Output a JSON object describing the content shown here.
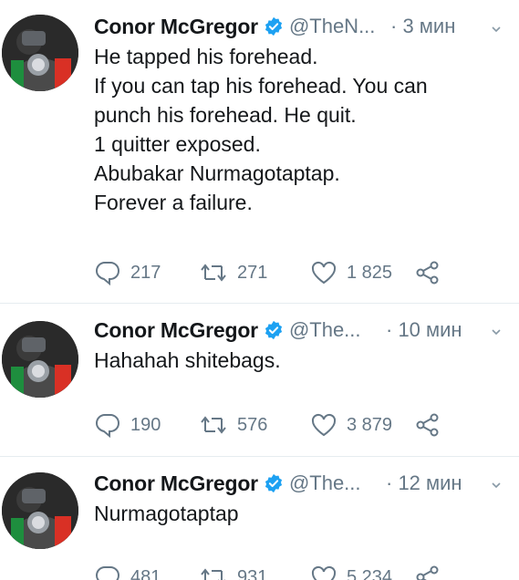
{
  "colors": {
    "text": "#14171a",
    "secondary": "#657786",
    "verified": "#1da1f2",
    "divider": "#e6ecf0"
  },
  "tweets": [
    {
      "name": "Conor McGregor",
      "handle": "@TheN...",
      "time": "· 3 мин",
      "lines": [
        "He tapped his forehead.",
        "If you can tap his forehead. You can",
        "punch his forehead. He quit.",
        "1 quitter exposed.",
        "Abubakar Nurmagotaptap.",
        "Forever a failure."
      ],
      "replies": "217",
      "retweets": "271",
      "likes": "1 825"
    },
    {
      "name": "Conor McGregor",
      "handle": "@The...",
      "time": "· 10 мин",
      "lines": [
        "Hahahah shitebags."
      ],
      "replies": "190",
      "retweets": "576",
      "likes": "3 879"
    },
    {
      "name": "Conor McGregor",
      "handle": "@The...",
      "time": "· 12 мин",
      "lines": [
        "Nurmagotaptap"
      ],
      "replies": "481",
      "retweets": "931",
      "likes": "5 234"
    }
  ],
  "icons": {
    "verified": "verified-badge-icon",
    "reply": "reply-icon",
    "retweet": "retweet-icon",
    "like": "heart-icon",
    "share": "share-icon",
    "more": "chevron-down-icon"
  }
}
